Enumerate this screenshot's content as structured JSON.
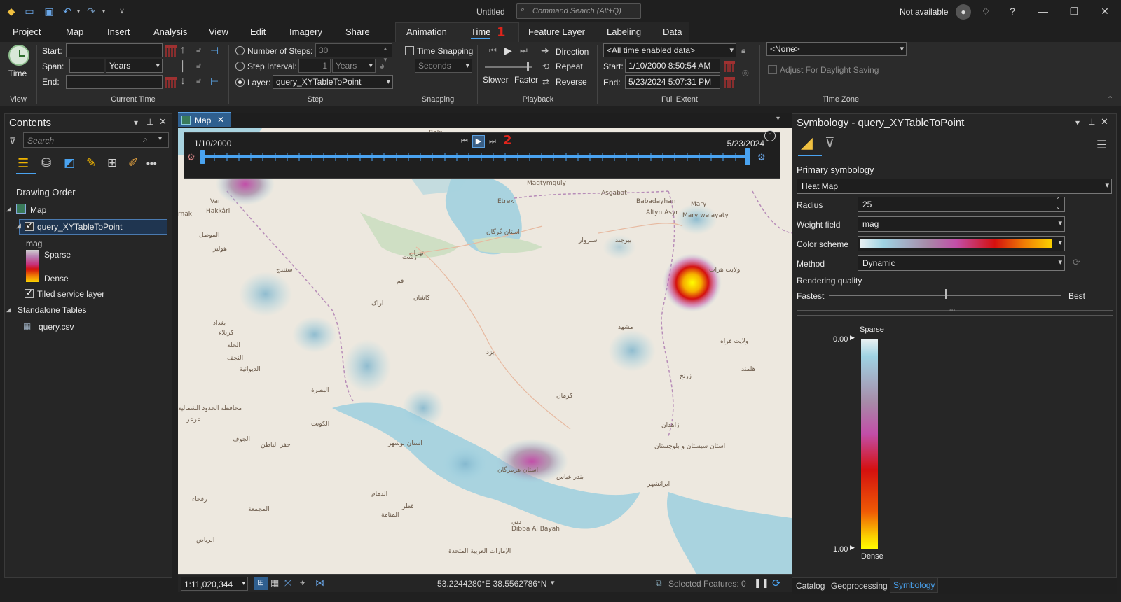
{
  "app": {
    "doc_title": "Untitled",
    "command_search_placeholder": "Command Search (Alt+Q)",
    "user_status": "Not available"
  },
  "menu_tabs": [
    "Project",
    "Map",
    "Insert",
    "Analysis",
    "View",
    "Edit",
    "Imagery",
    "Share",
    "Animation",
    "Time",
    "Feature Layer",
    "Labeling",
    "Data"
  ],
  "annotations": {
    "marker1": "1",
    "marker2": "2"
  },
  "ribbon": {
    "view_group": {
      "time_button": "Time",
      "label": "View"
    },
    "current_time": {
      "label": "Current Time",
      "start_label": "Start:",
      "span_label": "Span:",
      "end_label": "End:",
      "start_value": "",
      "span_value": "",
      "span_unit": "Years",
      "end_value": ""
    },
    "step": {
      "label": "Step",
      "number_of_steps_label": "Number of Steps:",
      "number_of_steps_value": "30",
      "step_interval_label": "Step Interval:",
      "step_interval_value": "1",
      "step_interval_unit": "Years",
      "layer_label": "Layer:",
      "layer_value": "query_XYTableToPoint",
      "selected_option": "Layer"
    },
    "snapping": {
      "label": "Snapping",
      "time_snapping_label": "Time Snapping",
      "time_snapping_checked": false,
      "unit": "Seconds"
    },
    "playback": {
      "label": "Playback",
      "slower": "Slower",
      "faster": "Faster",
      "direction": "Direction",
      "repeat": "Repeat",
      "reverse": "Reverse"
    },
    "full_extent": {
      "label": "Full Extent",
      "source": "<All time enabled data>",
      "start_label": "Start:",
      "start_value": "1/10/2000 8:50:54 AM",
      "end_label": "End:",
      "end_value": "5/23/2024 5:07:31 PM"
    },
    "time_zone": {
      "label": "Time Zone",
      "value": "<None>",
      "daylight_saving_label": "Adjust For Daylight Saving",
      "daylight_saving_checked": false
    }
  },
  "contents": {
    "title": "Contents",
    "search_placeholder": "Search",
    "drawing_order": "Drawing Order",
    "tree": {
      "map": "Map",
      "layer": "query_XYTableToPoint",
      "field": "mag",
      "sparse": "Sparse",
      "dense": "Dense",
      "tiled": "Tiled service layer",
      "standalone": "Standalone Tables",
      "table": "query.csv"
    }
  },
  "map": {
    "tab_label": "Map",
    "time_slider": {
      "start_date": "1/10/2000",
      "end_date": "5/23/2024",
      "ticks": 45
    },
    "scale": "1:11,020,344",
    "coordinates": "53.2244280°E 38.5562786°N",
    "selected_features": "Selected Features: 0",
    "labels": [
      {
        "text": "Baki"
      },
      {
        "text": "Magtymguly"
      },
      {
        "text": "Asgabat"
      },
      {
        "text": "Babadayhan"
      },
      {
        "text": "Mary"
      },
      {
        "text": "Altyn Asyr"
      },
      {
        "text": "Mary welayaty"
      },
      {
        "text": "Etrek"
      },
      {
        "text": "Hakkâri"
      },
      {
        "text": "rnak"
      },
      {
        "text": "Van"
      },
      {
        "text": "الموصل"
      },
      {
        "text": "هولير"
      },
      {
        "text": "سنندج"
      },
      {
        "text": "تهران"
      },
      {
        "text": "قم"
      },
      {
        "text": "اراک"
      },
      {
        "text": "كاشان"
      },
      {
        "text": "بغداد"
      },
      {
        "text": "كربلاء"
      },
      {
        "text": "الحلة"
      },
      {
        "text": "النجف"
      },
      {
        "text": "الديوانية"
      },
      {
        "text": "البصرة"
      },
      {
        "text": "الكويت"
      },
      {
        "text": "يزد"
      },
      {
        "text": "كرمان"
      },
      {
        "text": "مشهد"
      },
      {
        "text": "بيرجند"
      },
      {
        "text": "زاهدان"
      },
      {
        "text": "ایرانشهر"
      },
      {
        "text": "بندر عباس"
      },
      {
        "text": "استان هرمزگان"
      },
      {
        "text": "استان بوشهر"
      },
      {
        "text": "الدمام"
      },
      {
        "text": "الرياض"
      },
      {
        "text": "الإمارات العربية المتحدة"
      },
      {
        "text": "Dibba Al Bayah"
      },
      {
        "text": "دبي"
      },
      {
        "text": "قطر"
      },
      {
        "text": "المنامة"
      },
      {
        "text": "استان گرگان"
      },
      {
        "text": "رشت"
      },
      {
        "text": "سبزوار"
      },
      {
        "text": "ولايت هرات"
      },
      {
        "text": "ولايت فراه"
      },
      {
        "text": "هلمند"
      },
      {
        "text": "زرنج"
      },
      {
        "text": "استان سیستان و بلوچستان"
      },
      {
        "text": "الجوف"
      },
      {
        "text": "حفر الباطن"
      },
      {
        "text": "المجمعة"
      },
      {
        "text": "رفحاء"
      },
      {
        "text": "عرعر"
      },
      {
        "text": "محافظة الحدود الشمالية"
      }
    ]
  },
  "symbology": {
    "title": "Symbology - query_XYTableToPoint",
    "primary_heading": "Primary symbology",
    "renderer": "Heat Map",
    "radius_label": "Radius",
    "radius_value": "25",
    "weight_label": "Weight field",
    "weight_value": "mag",
    "color_scheme_label": "Color scheme",
    "method_label": "Method",
    "method_value": "Dynamic",
    "rendering_quality_label": "Rendering quality",
    "fastest": "Fastest",
    "best": "Best",
    "rendering_quality_level": 0.5,
    "legend_sparse": "Sparse",
    "legend_dense": "Dense",
    "legend_min": "0.00",
    "legend_max": "1.00",
    "colors": [
      "#9fd3e3",
      "#a78aa8",
      "#c24ea8",
      "#d4100f",
      "#ef5a05",
      "#fbd200",
      "#ffff00"
    ]
  },
  "bottom_tabs": [
    "Catalog",
    "Geoprocessing",
    "Symbology"
  ],
  "colors": {
    "accent": "#4aa3f0",
    "marker": "#e0241b"
  }
}
